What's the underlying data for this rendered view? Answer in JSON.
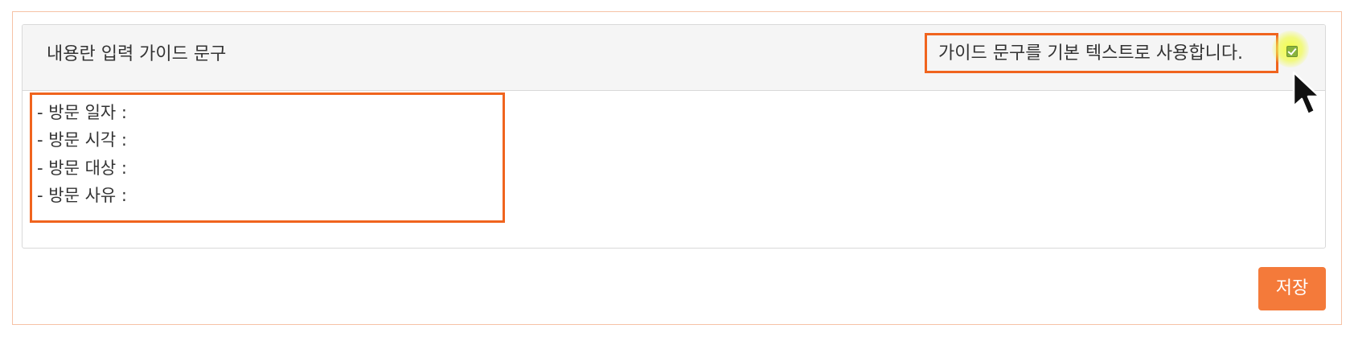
{
  "panel": {
    "title": "내용란 입력 가이드 문구",
    "option_label": "가이드 문구를 기본 텍스트로 사용합니다.",
    "option_checked": true
  },
  "content": {
    "lines": [
      "- 방문 일자 :",
      "- 방문 시각 :",
      "- 방문 대상 :",
      "- 방문 사유 :"
    ]
  },
  "actions": {
    "save_label": "저장"
  },
  "colors": {
    "accent": "#f0641e",
    "button": "#f47a3a",
    "checkbox": "#8ab43e",
    "header_bg": "#f5f5f5"
  },
  "icons": {
    "cursor": "mouse-pointer-icon",
    "check": "checkmark-icon"
  }
}
